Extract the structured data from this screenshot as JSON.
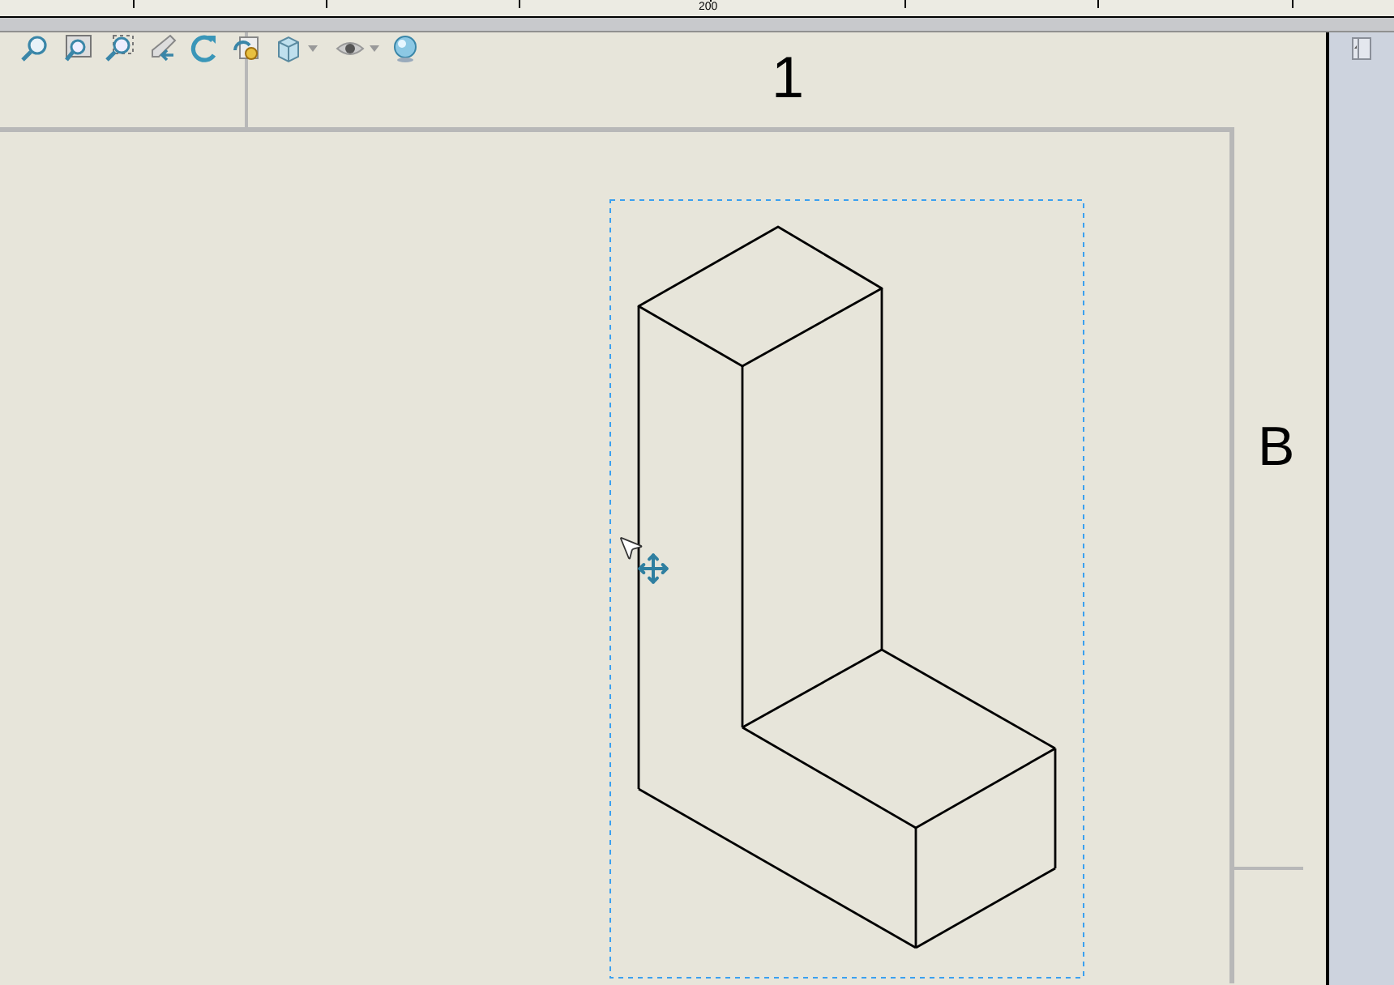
{
  "ruler": {
    "label": "200"
  },
  "sheet": {
    "zone_column": "1",
    "zone_row": "B"
  }
}
